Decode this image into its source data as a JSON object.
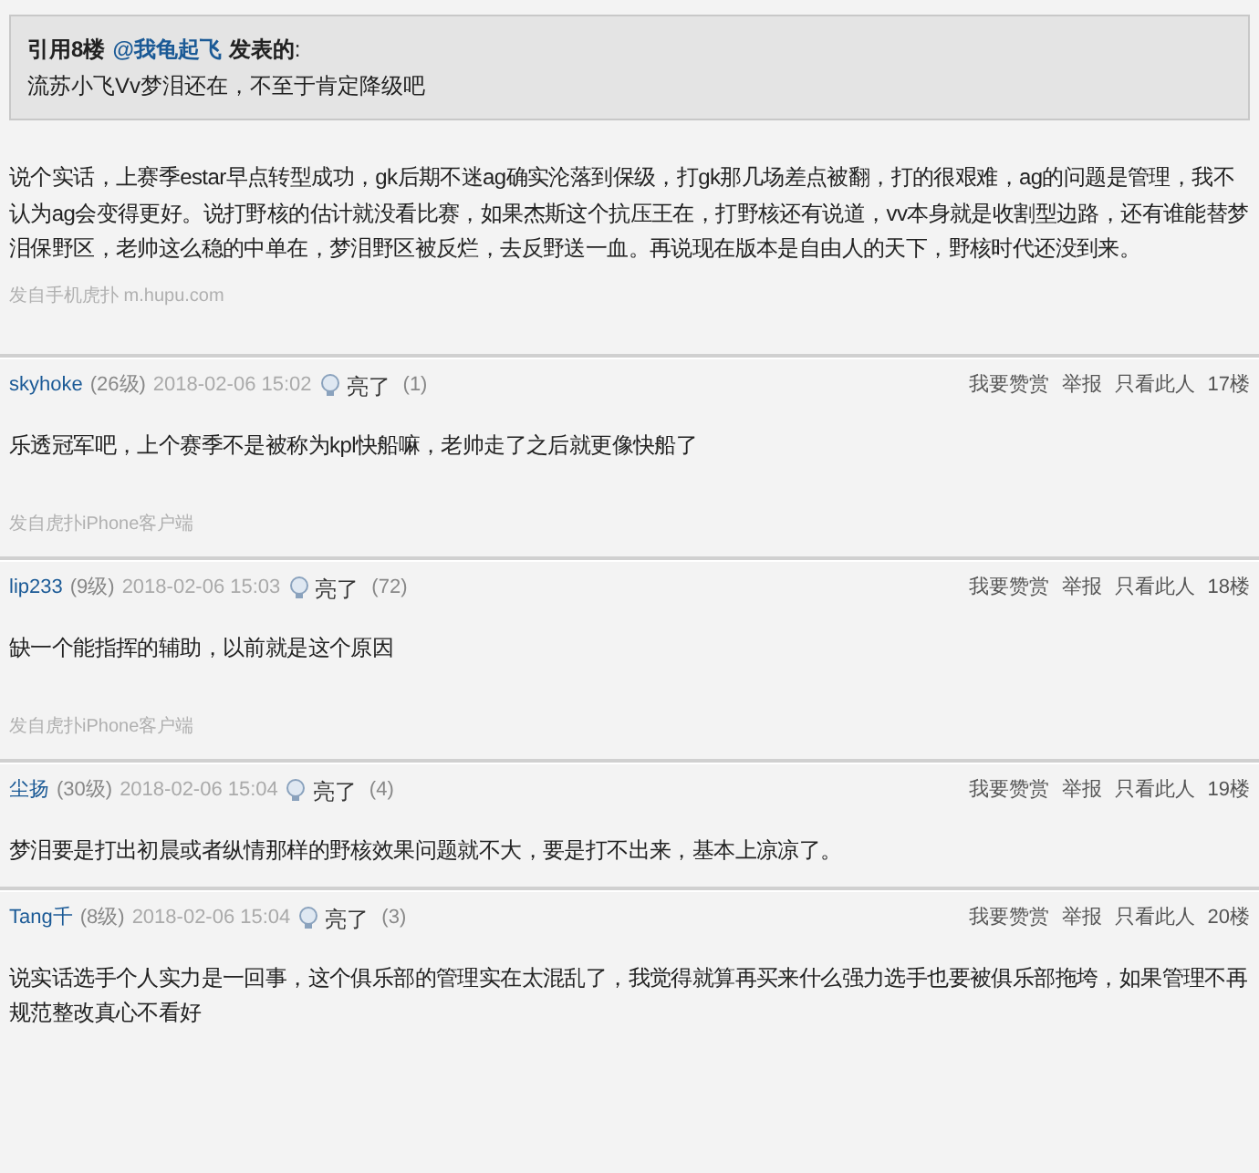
{
  "quote": {
    "prefix": "引用8楼",
    "author": "@我龟起飞",
    "suffix": "发表的",
    "colon": ":",
    "text": "流苏小飞Vv梦泪还在，不至于肯定降级吧"
  },
  "reply": {
    "text": "说个实话，上赛季estar早点转型成功，gk后期不迷ag确实沦落到保级，打gk那几场差点被翻，打的很艰难，ag的问题是管理，我不认为ag会变得更好。说打野核的估计就没看比赛，如果杰斯这个抗压王在，打野核还有说道，vv本身就是收割型边路，还有谁能替梦泪保野区，老帅这么稳的中单在，梦泪野区被反烂，去反野送一血。再说现在版本是自由人的天下，野核时代还没到来。",
    "source": "发自手机虎扑 m.hupu.com"
  },
  "posts": [
    {
      "user": "skyhoke",
      "level": "(26级)",
      "time": "2018-02-06 15:02",
      "light": "亮了",
      "light_count": "(1)",
      "actions": [
        "我要赞赏",
        "举报",
        "只看此人"
      ],
      "floor": "17楼",
      "text": "乐透冠军吧，上个赛季不是被称为kpl快船嘛，老帅走了之后就更像快船了",
      "source": "发自虎扑iPhone客户端"
    },
    {
      "user": "lip233",
      "level": "(9级)",
      "time": "2018-02-06 15:03",
      "light": "亮了",
      "light_count": "(72)",
      "actions": [
        "我要赞赏",
        "举报",
        "只看此人"
      ],
      "floor": "18楼",
      "text": "缺一个能指挥的辅助，以前就是这个原因",
      "source": "发自虎扑iPhone客户端"
    },
    {
      "user": "尘扬",
      "level": "(30级)",
      "time": "2018-02-06 15:04",
      "light": "亮了",
      "light_count": "(4)",
      "actions": [
        "我要赞赏",
        "举报",
        "只看此人"
      ],
      "floor": "19楼",
      "text": "梦泪要是打出初晨或者纵情那样的野核效果问题就不大，要是打不出来，基本上凉凉了。"
    },
    {
      "user": "Tang千",
      "level": "(8级)",
      "time": "2018-02-06 15:04",
      "light": "亮了",
      "light_count": "(3)",
      "actions": [
        "我要赞赏",
        "举报",
        "只看此人"
      ],
      "floor": "20楼",
      "text": "说实话选手个人实力是一回事，这个俱乐部的管理实在太混乱了，我觉得就算再买来什么强力选手也要被俱乐部拖垮，如果管理不再规范整改真心不看好"
    }
  ]
}
